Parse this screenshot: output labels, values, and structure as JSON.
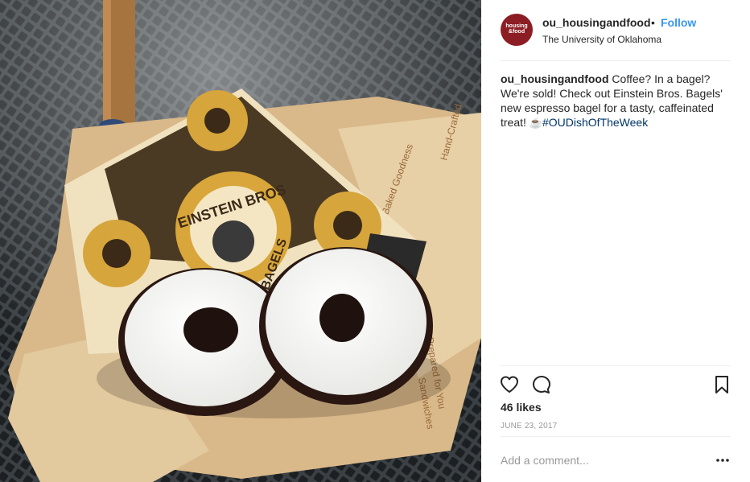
{
  "post": {
    "username": "ou_housingandfood",
    "separator": "•",
    "follow_label": "Follow",
    "location": "The University of Oklahoma",
    "avatar_text": "housing\n&food",
    "caption": {
      "username": "ou_housingandfood",
      "text": "Coffee? In a bagel? We're sold! Check out Einstein Bros. Bagels' new espresso bagel for a tasty, caffeinated treat!",
      "emoji": "☕",
      "hashtag": "#OUDishOfTheWeek"
    },
    "likes": "46 likes",
    "date": "JUNE 23, 2017",
    "comment_placeholder": "Add a comment...",
    "photo": {
      "bag_brand_line1": "EINSTEIN BROS",
      "bag_brand_line2": "BAGELS",
      "wrap_text_1": "Fresh-Baked Goodness",
      "wrap_text_2": "Hand-Crafted",
      "wrap_text_3": "Prepared for You",
      "wrap_text_4": "Sandwiches"
    }
  },
  "icons": {
    "like": "heart-icon",
    "comment": "comment-icon",
    "save": "bookmark-icon",
    "more": "more-options-icon"
  },
  "colors": {
    "follow": "#3897f0",
    "hashtag": "#003569",
    "muted": "#999999",
    "avatar_bg": "#8c1d24"
  }
}
